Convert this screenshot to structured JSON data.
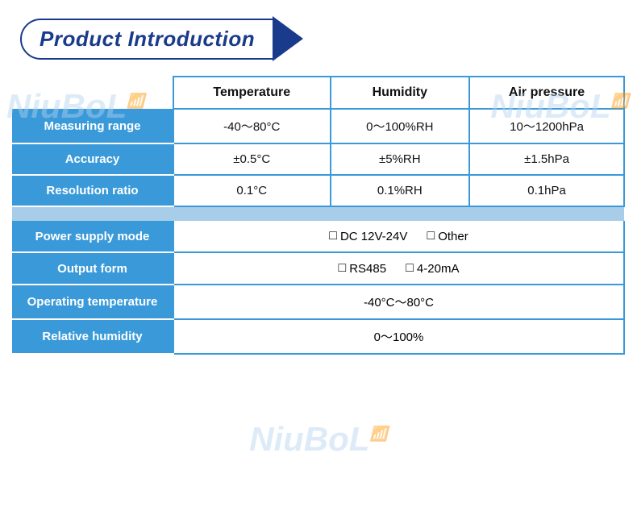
{
  "title": "Product Introduction",
  "watermark": "NiuBoL",
  "table": {
    "headers": [
      "",
      "Temperature",
      "Humidity",
      "Air pressure"
    ],
    "rows": [
      {
        "label": "Measuring range",
        "temperature": "-40～80°C",
        "humidity": "0～100%RH",
        "air_pressure": "10～1200hPa"
      },
      {
        "label": "Accuracy",
        "temperature": "±0.5°C",
        "humidity": "±5%RH",
        "air_pressure": "±1.5hPa"
      },
      {
        "label": "Resolution ratio",
        "temperature": "0.1°C",
        "humidity": "0.1%RH",
        "air_pressure": "0.1hPa"
      }
    ],
    "wide_rows": [
      {
        "label": "Power supply mode",
        "options": [
          {
            "prefix": "DC 12V-24V"
          },
          {
            "prefix": "Other"
          }
        ],
        "value_text": "DC 12V-24V   Other"
      },
      {
        "label": "Output form",
        "value_text": "RS485   4-20mA"
      },
      {
        "label": "Operating temperature",
        "value_text": "-40°C～80°C"
      },
      {
        "label": "Relative humidity",
        "value_text": "0～100%"
      }
    ]
  }
}
